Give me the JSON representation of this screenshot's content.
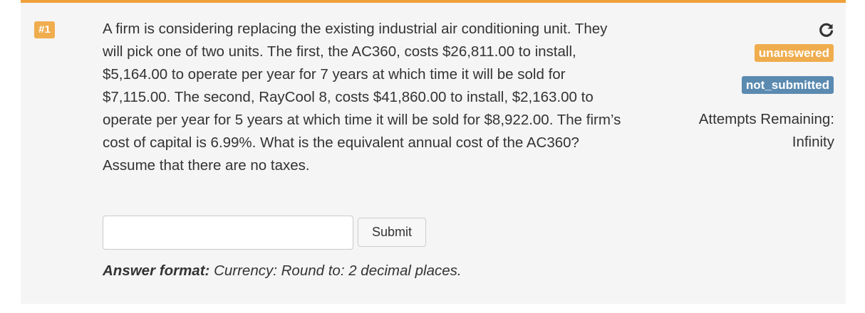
{
  "question": {
    "number_label": "#1",
    "text": "A firm is considering replacing the existing industrial air conditioning unit. They will pick one of two units. The first, the AC360, costs $26,811.00 to install, $5,164.00 to operate per year for 7 years at which time it will be sold for $7,115.00. The second, RayCool 8, costs $41,860.00 to install, $2,163.00 to operate per year for 5 years at which time it will be sold for $8,922.00. The firm’s cost of capital is 6.99%. What is the equivalent annual cost of the AC360? Assume that there are no taxes."
  },
  "answer": {
    "input_value": "",
    "submit_label": "Submit",
    "format_label": "Answer format:",
    "format_value": "Currency: Round to: 2 decimal places."
  },
  "status": {
    "answer_badge": "unanswered",
    "submission_badge": "not_submitted",
    "attempts_label": "Attempts Remaining:",
    "attempts_value": "Infinity"
  },
  "icons": {
    "reload": "reload-icon"
  },
  "colors": {
    "accent_orange": "#f0ad4e",
    "top_border": "#f0a03a",
    "badge_blue": "#5b8ab1",
    "panel_bg": "#f5f5f5"
  }
}
